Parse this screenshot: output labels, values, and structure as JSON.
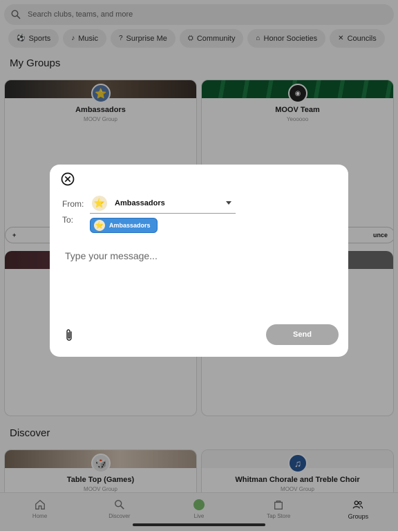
{
  "search": {
    "placeholder": "Search clubs, teams, and more"
  },
  "chips": [
    {
      "label": "Sports",
      "icon": "⚽"
    },
    {
      "label": "Music",
      "icon": "♪"
    },
    {
      "label": "Surprise Me",
      "icon": "?"
    },
    {
      "label": "Community",
      "icon": "⛭"
    },
    {
      "label": "Honor Societies",
      "icon": "⌂"
    },
    {
      "label": "Councils",
      "icon": "✕"
    }
  ],
  "my_groups": {
    "title": "My Groups",
    "cards": [
      {
        "title": "Ambassadors",
        "subtitle": "MOOV Group",
        "avatar": "star-avatar"
      },
      {
        "title": "MOOV Team",
        "subtitle": "Yeooooo",
        "avatar": "moov-logo"
      }
    ],
    "button_partial_left": "+",
    "button_partial_right": "unce"
  },
  "discover": {
    "title": "Discover",
    "cards": [
      {
        "title": "Table Top (Games)",
        "subtitle": "MOOV Group",
        "avatar": "dice-avatar"
      },
      {
        "title": "Whitman Chorale and Treble Choir",
        "subtitle": "MOOV Group",
        "avatar": "music-note-avatar"
      }
    ]
  },
  "tabbar": {
    "items": [
      {
        "label": "Home",
        "icon": "home-icon"
      },
      {
        "label": "Discover",
        "icon": "search-icon"
      },
      {
        "label": "Live",
        "icon": "live-dot-icon"
      },
      {
        "label": "Tap Store",
        "icon": "bag-icon"
      },
      {
        "label": "Groups",
        "icon": "groups-icon",
        "active": true
      }
    ]
  },
  "modal": {
    "from_label": "From:",
    "to_label": "To:",
    "from_value": "Ambassadors",
    "to_chip": "Ambassadors",
    "message_placeholder": "Type your message...",
    "send_label": "Send"
  },
  "colors": {
    "accent_blue": "#3f8fdc",
    "send_disabled": "#a8a8a8",
    "live_green": "#7dbf6f"
  }
}
